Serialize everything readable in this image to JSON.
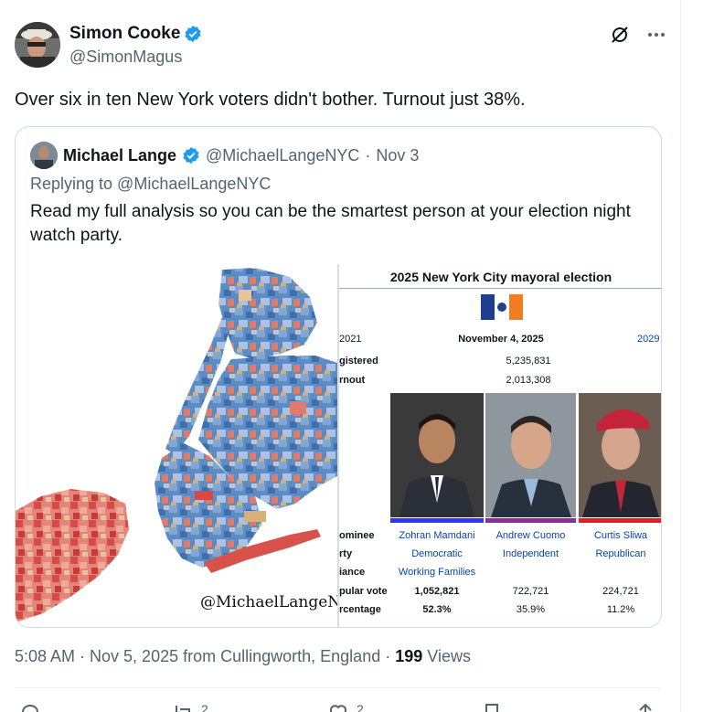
{
  "tweet": {
    "author": {
      "name": "Simon Cooke",
      "handle": "@SimonMagus"
    },
    "text": "Over six in ten New York voters didn't bother. Turnout just 38%.",
    "timestamp": "5:08 AM · Nov 5, 2025 from Cullingworth, England",
    "views_count": "199",
    "views_label": "Views",
    "actions": {
      "replies": "",
      "reposts": "2",
      "likes": "2"
    }
  },
  "quote": {
    "author": {
      "name": "Michael Lange",
      "handle": "@MichaelLangeNYC",
      "date": "Nov 3"
    },
    "replying_to": "Replying to @MichaelLangeNYC",
    "text": "Read my full analysis so you can be the smartest person at your election night watch party.",
    "map_watermark": "@MichaelLangeNYC"
  },
  "infobox": {
    "title": "2025 New York City mayoral election",
    "prev_year": "2021",
    "date": "November 4, 2025",
    "next_year": "2029",
    "registered_label": "gistered",
    "registered_value": "5,235,831",
    "turnout_label": "rnout",
    "turnout_value": "2,013,308",
    "row_labels": {
      "nominee": "ominee",
      "party": "rty",
      "alliance": "iance",
      "popular_vote": "pular vote",
      "percentage": "rcentage"
    },
    "candidates": [
      {
        "name": "Zohran Mamdani",
        "party": "Democratic",
        "alliance": "Working Families",
        "votes": "1,052,821",
        "percentage": "52.3%",
        "color": "#3333ff"
      },
      {
        "name": "Andrew Cuomo",
        "party": "Independent",
        "alliance": "",
        "votes": "722,721",
        "percentage": "35.9%",
        "color": "#8e2ca0"
      },
      {
        "name": "Curtis Sliwa",
        "party": "Republican",
        "alliance": "",
        "votes": "224,721",
        "percentage": "11.2%",
        "color": "#e81b23"
      }
    ]
  }
}
